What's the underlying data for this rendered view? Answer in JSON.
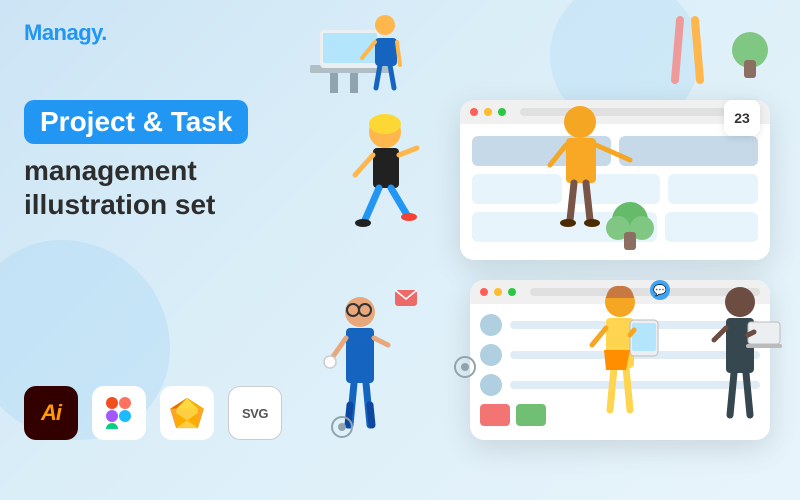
{
  "logo": {
    "text": "Managy."
  },
  "title": {
    "highlight": "Project & Task",
    "line2": "management",
    "line3": "illustration set"
  },
  "format_icons": [
    {
      "id": "ai",
      "label": "Ai",
      "bg": "#300",
      "color": "#ff9a00"
    },
    {
      "id": "figma",
      "label": "figma",
      "bg": "#fff"
    },
    {
      "id": "sketch",
      "label": "sketch",
      "bg": "#fff"
    },
    {
      "id": "svg",
      "label": "SVG",
      "bg": "#fff"
    }
  ],
  "calendar_badge": "23",
  "browser_top": {
    "cards": [
      {
        "type": "wide"
      },
      {
        "type": "wide"
      },
      {
        "type": "wide"
      }
    ]
  },
  "browser_bottom": {
    "users": 3,
    "progress_items": 2
  },
  "colors": {
    "brand_blue": "#2196F3",
    "bg_light": "#daeaf8",
    "white": "#ffffff"
  }
}
